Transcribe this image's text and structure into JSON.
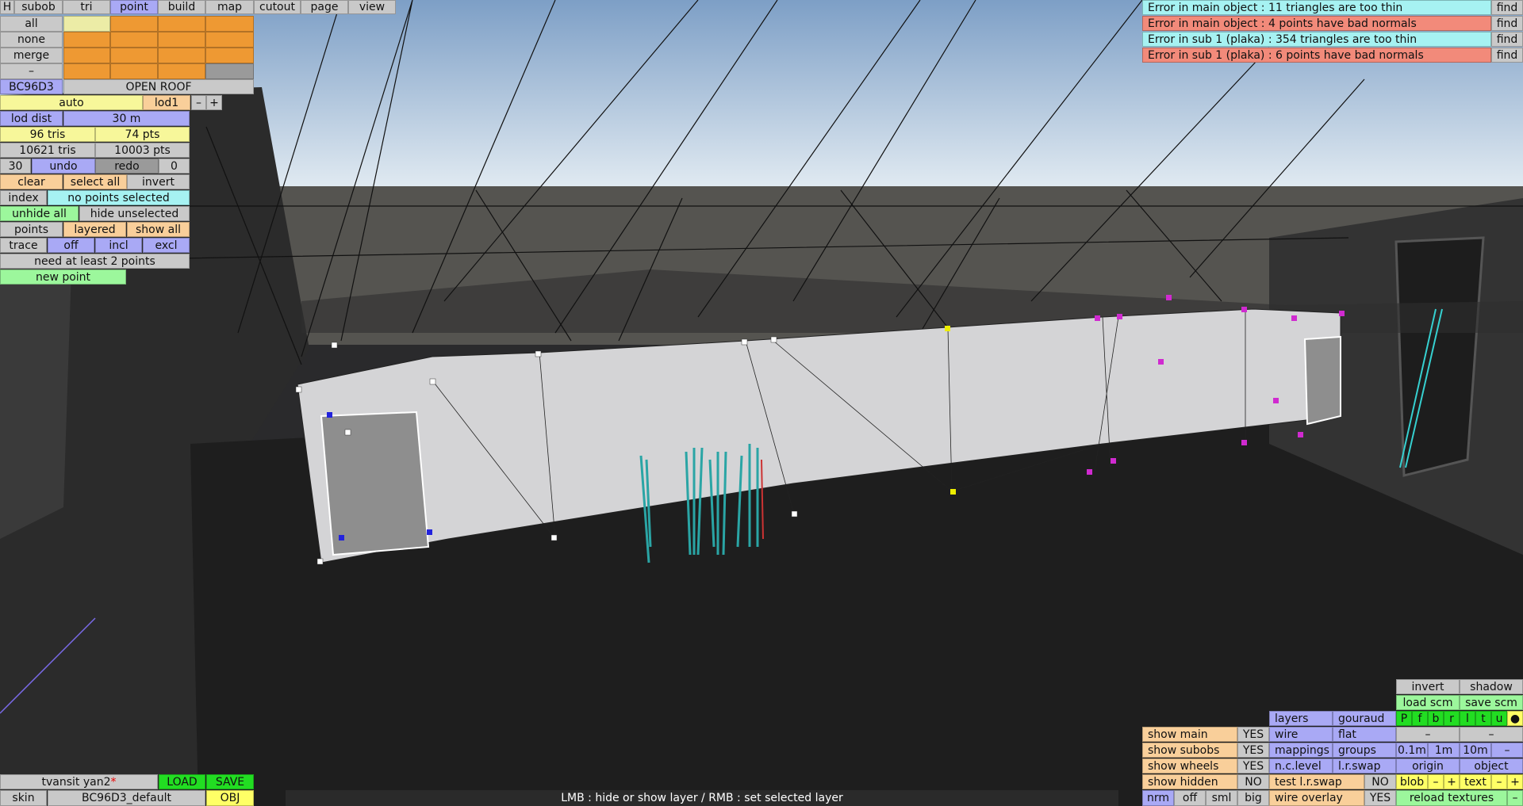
{
  "menu": {
    "h": "H",
    "tabs": [
      "subob",
      "tri",
      "point",
      "build",
      "map",
      "cutout",
      "page",
      "view"
    ],
    "active_tab": "point"
  },
  "selection": {
    "all": "all",
    "none": "none",
    "merge": "merge",
    "dash": "–"
  },
  "object": {
    "id": "BC96D3",
    "name": "OPEN ROOF",
    "lod_mode": "auto",
    "lod": "lod1",
    "minus": "–",
    "plus": "+",
    "lod_dist_label": "lod dist",
    "lod_dist": "30 m",
    "tris_sel": "96 tris",
    "pts_sel": "74 pts",
    "tris_total": "10621 tris",
    "pts_total": "10003 pts",
    "undo_count": "30",
    "undo": "undo",
    "redo": "redo",
    "redo_count": "0"
  },
  "point_tools": {
    "clear": "clear",
    "select_all": "select all",
    "invert": "invert",
    "index": "index",
    "status": "no points selected",
    "unhide_all": "unhide all",
    "hide_unselected": "hide unselected",
    "points": "points",
    "layered": "layered",
    "show_all": "show all",
    "trace": "trace",
    "off": "off",
    "incl": "incl",
    "excl": "excl",
    "hint": "need at least 2 points",
    "new_point": "new point"
  },
  "errors": [
    {
      "text": "Error in main object : 11 triangles are too thin",
      "find": "find",
      "color": "#a6f2f2"
    },
    {
      "text": "Error in main object : 4 points have bad normals",
      "find": "find",
      "color": "#f28a7a"
    },
    {
      "text": "Error in sub 1 (plaka) : 354 triangles are too thin",
      "find": "find",
      "color": "#a6f2f2"
    },
    {
      "text": "Error in sub 1 (plaka) : 6 points have bad normals",
      "find": "find",
      "color": "#f28a7a"
    }
  ],
  "bottom_left": {
    "file": "tvansit yan2",
    "modified": "*",
    "load": "LOAD",
    "save": "SAVE",
    "skin_label": "skin",
    "skin": "BC96D3_default",
    "obj": "OBJ"
  },
  "status_bar": "LMB : hide or show layer / RMB : set selected layer",
  "view_panel": {
    "show_main": "show main",
    "show_main_v": "YES",
    "show_subobs": "show subobs",
    "show_subobs_v": "YES",
    "show_wheels": "show wheels",
    "show_wheels_v": "YES",
    "show_hidden": "show hidden",
    "show_hidden_v": "NO",
    "nrm": "nrm",
    "off": "off",
    "sml": "sml",
    "big": "big",
    "layers": "layers",
    "gouraud": "gouraud",
    "wire": "wire",
    "flat": "flat",
    "mappings": "mappings",
    "groups": "groups",
    "nc_level": "n.c.level",
    "lr_swap": "l.r.swap",
    "test_lr_swap": "test l.r.swap",
    "test_lr_swap_v": "NO",
    "wire_overlay": "wire overlay",
    "wire_overlay_v": "YES",
    "invert": "invert",
    "shadow": "shadow",
    "load_scm": "load scm",
    "save_scm": "save scm",
    "channels": [
      "P",
      "f",
      "b",
      "r",
      "l",
      "t",
      "u",
      "●"
    ],
    "dash": "–",
    "d01": "0.1m",
    "d1": "1m",
    "d10": "10m",
    "origin": "origin",
    "object": "object",
    "blob": "blob",
    "text": "text",
    "plus": "+",
    "reload_textures": "reload textures"
  }
}
